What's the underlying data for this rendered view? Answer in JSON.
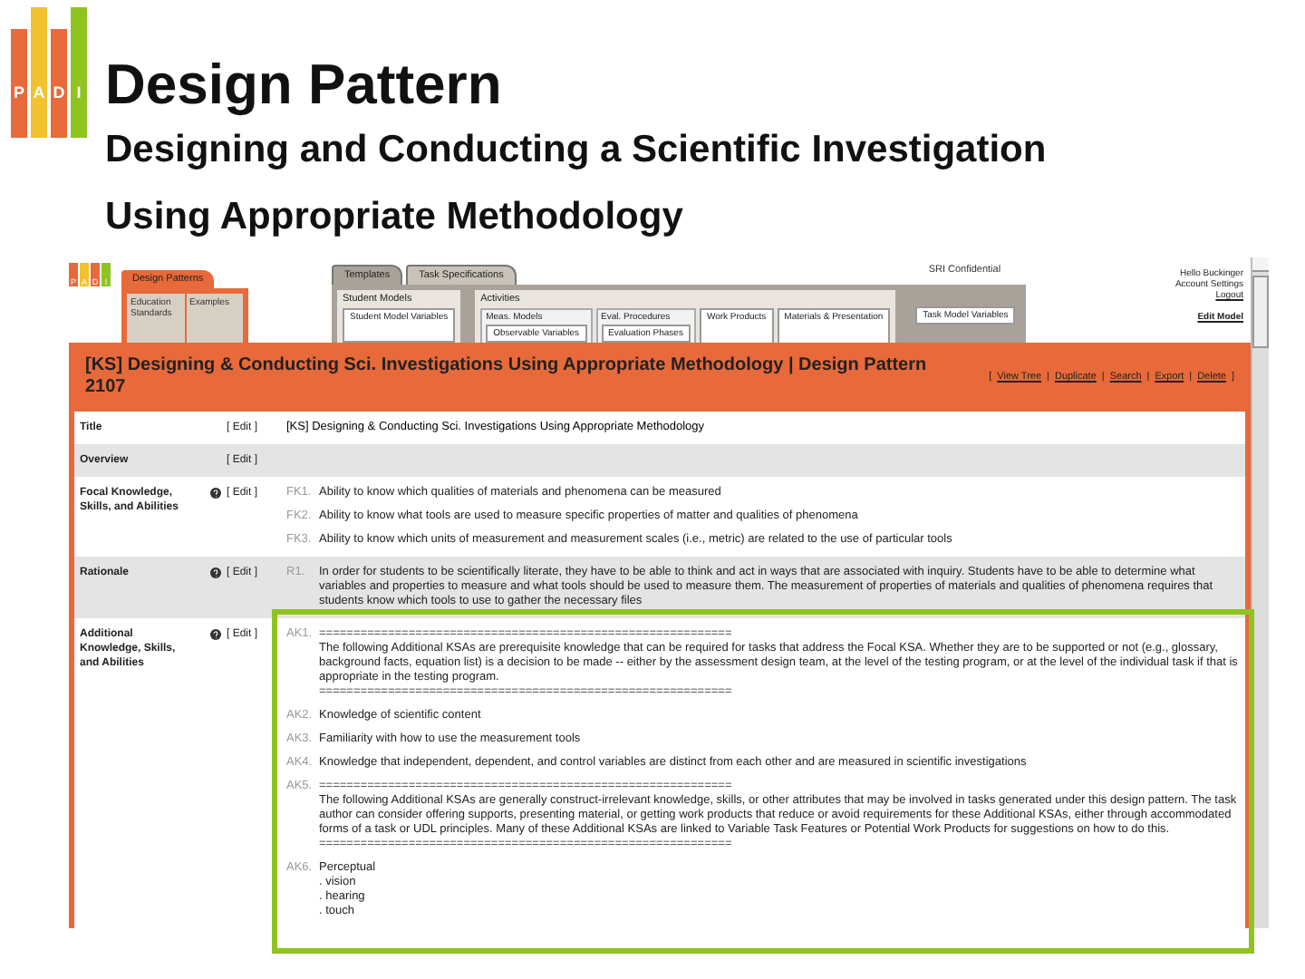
{
  "slide": {
    "logo": [
      "P",
      "A",
      "D",
      "I"
    ],
    "title": "Design Pattern",
    "subtitle": "Designing and Conducting a Scientific Investigation Using Appropriate Methodology"
  },
  "app": {
    "logo": [
      "P",
      "A",
      "D",
      "I"
    ],
    "section_tabs": [
      {
        "label": "Design Patterns",
        "selected": true,
        "items": [
          "Education Standards",
          "Examples"
        ]
      }
    ],
    "tabs": [
      {
        "label": "Templates",
        "selected": true
      },
      {
        "label": "Task Specifications",
        "selected": false
      }
    ],
    "confidential": "SRI Confidential",
    "student_models": {
      "label": "Student Models",
      "items": [
        "Student Model Variables"
      ]
    },
    "activities": {
      "label": "Activities",
      "groups": [
        {
          "label": "Meas. Models",
          "item": "Observable Variables"
        },
        {
          "label": "Eval. Procedures",
          "item": "Evaluation Phases"
        }
      ],
      "items": [
        "Work Products",
        "Materials & Presentation"
      ]
    },
    "task_model": "Task Model Variables",
    "user": {
      "greeting": "Hello Buckinger",
      "settings": "Account Settings",
      "logout": "Logout",
      "edit_model": "Edit Model"
    },
    "header": {
      "title": "[KS] Designing & Conducting Sci. Investigations Using Appropriate Methodology | Design Pattern 2107",
      "open": "[",
      "close": "]",
      "separator": "|",
      "actions": [
        "View Tree",
        "Duplicate",
        "Search",
        "Export",
        "Delete"
      ]
    },
    "rows": [
      {
        "label": "Title",
        "help": false,
        "edit": "[ Edit ]",
        "text": "[KS] Designing & Conducting Sci. Investigations Using Appropriate Methodology"
      },
      {
        "label": "Overview",
        "help": false,
        "edit": "[ Edit ]"
      },
      {
        "label": "Focal Knowledge, Skills, and Abilities",
        "help": true,
        "edit": "[ Edit ]",
        "items": [
          {
            "label": "FK1.",
            "lines": [
              "Ability to know which qualities of materials and phenomena can be measured"
            ]
          },
          {
            "label": "FK2.",
            "lines": [
              "Ability to know what tools are used to measure specific properties of matter and qualities of phenomena"
            ]
          },
          {
            "label": "FK3.",
            "lines": [
              "Ability to know which units of measurement and measurement scales (i.e., metric) are related to the use of particular tools"
            ]
          }
        ]
      },
      {
        "label": "Rationale",
        "help": true,
        "edit": "[ Edit ]",
        "items": [
          {
            "label": "R1.",
            "lines": [
              "In order for students to be scientifically literate, they have to be able to think and act in ways that are associated with inquiry. Students have to be able to determine what variables and properties to measure and what tools should be used to measure them. The measurement of properties of materials and qualities of phenomena requires that students know which tools to use to gather the necessary files"
            ]
          }
        ]
      },
      {
        "label": "Additional Knowledge, Skills, and Abilities",
        "help": true,
        "edit": "[ Edit ]",
        "items": [
          {
            "label": "AK1.",
            "lines": [
              "============================================================",
              "The following Additional KSAs are prerequisite knowledge that can be required for tasks that address the Focal KSA. Whether they are to be supported or not (e.g., glossary, background facts, equation list) is a decision to be made -- either by the assessment design team, at the level of the testing program, or at the level of the individual task if that is appropriate in the testing program.",
              "============================================================"
            ]
          },
          {
            "label": "AK2.",
            "lines": [
              "Knowledge of scientific content"
            ]
          },
          {
            "label": "AK3.",
            "lines": [
              "Familiarity with how to use the measurement tools"
            ]
          },
          {
            "label": "AK4.",
            "lines": [
              "Knowledge that independent, dependent, and control variables are distinct from each other and are measured in scientific investigations"
            ]
          },
          {
            "label": "AK5.",
            "lines": [
              "============================================================",
              "The following Additional KSAs are generally construct-irrelevant knowledge, skills, or other attributes that may be involved in tasks generated under this design pattern. The task author can consider offering supports, presenting material, or getting work products that reduce or avoid requirements for these Additional KSAs, either through accommodated forms of a task or UDL principles. Many of these Additional KSAs are linked to Variable Task Features or Potential Work Products for suggestions on how to do this.",
              "============================================================"
            ]
          },
          {
            "label": "AK6.",
            "lines": [
              "Perceptual",
              ". vision",
              ". hearing",
              ". touch"
            ]
          }
        ]
      }
    ]
  }
}
